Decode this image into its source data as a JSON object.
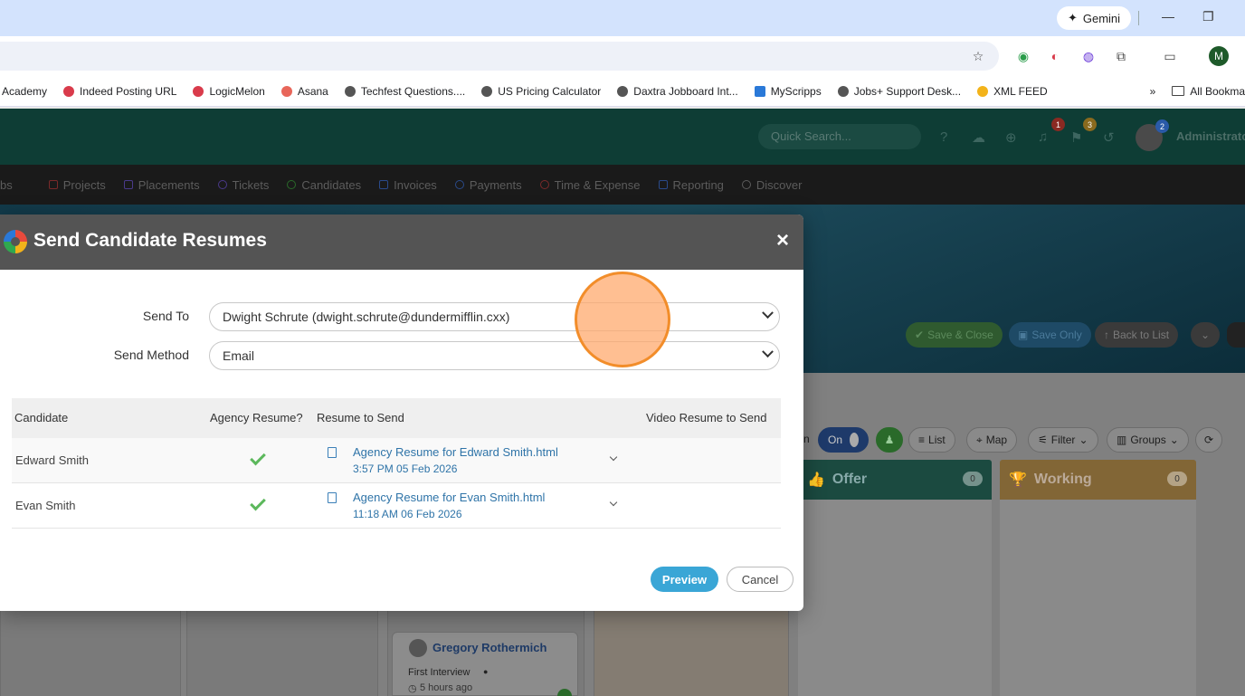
{
  "browser": {
    "gemini_label": "Gemini",
    "profile_initial": "M",
    "bookmarks": [
      {
        "label": "Academy",
        "color": ""
      },
      {
        "label": "Indeed Posting URL",
        "color": "#d93b4b"
      },
      {
        "label": "LogicMelon",
        "color": "#d93b4b"
      },
      {
        "label": "Asana",
        "color": "#e8665a"
      },
      {
        "label": "Techfest Questions....",
        "color": "#555"
      },
      {
        "label": "US Pricing Calculator",
        "color": "#555"
      },
      {
        "label": "Daxtra Jobboard Int...",
        "color": "#555"
      },
      {
        "label": "MyScripps",
        "color": "#2a79d8"
      },
      {
        "label": "Jobs+ Support Desk...",
        "color": "#555"
      },
      {
        "label": "XML FEED",
        "color": "#f3b31a"
      }
    ],
    "more_label": "»",
    "all_bookmarks_label": "All Bookma"
  },
  "app_header": {
    "quick_search_placeholder": "Quick Search...",
    "notif_badge": "1",
    "flag_badge": "3",
    "avatar_badge": "2",
    "admin_label": "Administrato"
  },
  "nav": {
    "items": [
      {
        "label": "bs",
        "color": ""
      },
      {
        "label": "Projects",
        "color": "#b33"
      },
      {
        "label": "Placements",
        "color": "#6a5acd"
      },
      {
        "label": "Tickets",
        "color": "#6a5acd"
      },
      {
        "label": "Candidates",
        "color": "#3a8a3a"
      },
      {
        "label": "Invoices",
        "color": "#3a5aa8"
      },
      {
        "label": "Payments",
        "color": "#3a5aa8"
      },
      {
        "label": "Time & Expense",
        "color": "#b33"
      },
      {
        "label": "Reporting",
        "color": "#3a5aa8"
      },
      {
        "label": "Discover",
        "color": "#5c5c5c"
      }
    ]
  },
  "page": {
    "save_close_label": "Save & Close",
    "save_only_label": "Save Only",
    "back_label": "Back to List",
    "toggle_prefix": "n",
    "toggle_label": "On",
    "list_label": "List",
    "map_label": "Map",
    "filter_label": "Filter",
    "groups_label": "Groups",
    "columns": [
      {
        "title": "Offer",
        "count": "0",
        "color": "#1b6b58"
      },
      {
        "title": "Working",
        "count": "0",
        "color": "#b88a2e"
      }
    ],
    "card": {
      "name": "Gregory Rothermich",
      "stage": "First Interview",
      "time": "5 hours ago"
    }
  },
  "modal": {
    "title": "Send Candidate Resumes",
    "close_label": "×",
    "send_to_label": "Send To",
    "send_to_value": "Dwight Schrute (dwight.schrute@dundermifflin.cxx)",
    "send_method_label": "Send Method",
    "send_method_value": "Email",
    "table": {
      "headers": {
        "candidate": "Candidate",
        "agency": "Agency Resume?",
        "resume": "Resume to Send",
        "video": "Video Resume to Send"
      },
      "rows": [
        {
          "name": "Edward Smith",
          "resume": "Agency Resume for Edward Smith.html",
          "date": "3:57 PM 05 Feb 2026"
        },
        {
          "name": "Evan Smith",
          "resume": "Agency Resume for Evan Smith.html",
          "date": "11:18 AM 06 Feb 2026"
        }
      ]
    },
    "preview_label": "Preview",
    "cancel_label": "Cancel"
  }
}
